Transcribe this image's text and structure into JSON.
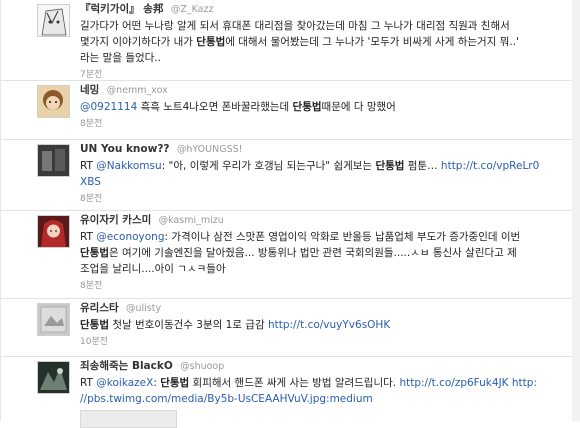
{
  "tweets": [
    {
      "name": "『럭키가이』 송邦",
      "screen": "@Z_Kazz",
      "line1": "길가다가 어떤 누나랑 알게 되서 휴대폰 대리점을 찾아갔는데 마침 그 누나가 대리점 직원과 친해서",
      "line2a": "몇가지 이야기하다가 내가 ",
      "kw": "단통법",
      "line2b": "에 대해서 물어봤는데 그 누나가 '모두가 비싸게 사게 하는거지 뭐..'",
      "line3": "라는 말을 들었다..",
      "time": "7분전"
    },
    {
      "name": "네밍",
      "screen": "@nemm_xox",
      "mention": "@0921114",
      "pre": " 흑흑 노트4나오면 폰바꿀라했는데 ",
      "kw": "단통법",
      "post": "때문에 다 망했어",
      "time": "8분전"
    },
    {
      "name": "UN You know??",
      "screen": "@hYOUNGSS!",
      "rt": "RT ",
      "mention": "@Nakkomsu",
      "pre": ": \"아, 이렇게 우리가 호갱님 되는구나\" 쉽게보는 ",
      "kw": "단통법",
      "post": " 펌툰… ",
      "link1": "http://t.co/vpReLr0",
      "link2": "XBS",
      "time": "8분전"
    },
    {
      "name": "유이자키 카스미",
      "screen": "@kasmi_mizu",
      "rt": "RT ",
      "mention": "@econoyong",
      "line1": ": 가격이나 삼전 스맛폰 영업이익 악화로 반올등 납품업체 부도가 증가중인데 이번",
      "kw": "단통법",
      "line2": "은 여기에 기솔엔진을 달아줬음... 방통위나 법만 관련 국회의원들.....ㅅㅂ 통신사 살린다고 제",
      "line3": "조업을 날리니....아이 ㄱㅅㅋ들아",
      "time": "8분전"
    },
    {
      "name": "유리스타",
      "screen": "@ulisty",
      "kw": "단통법",
      "pre": " 첫날 번호이동건수 3분의 1로 급감 ",
      "link": "http://t.co/vuyYv6sOHK",
      "time": "10분전"
    },
    {
      "name": "죄송해죽는 BlackO",
      "screen": "@shuoop",
      "rt": "RT ",
      "mention": "@koikazeX",
      "pre": ": ",
      "kw": "단통법",
      "post": " 회피해서 핸드폰 싸게 사는 방법 알려드립니다. ",
      "link1": "http://t.co/zp6Fuk4JK",
      "post2": " http:",
      "line2": "//pbs.twimg.com/media/By5b-UsCEAAHVuV.jpg:medium"
    }
  ]
}
